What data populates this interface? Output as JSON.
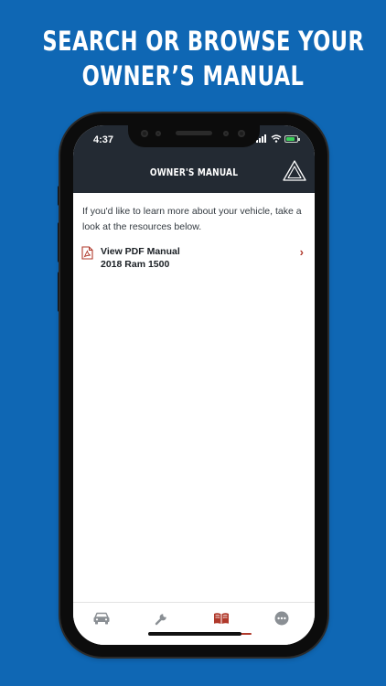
{
  "headline": {
    "line1": "SEARCH OR BROWSE YOUR",
    "line2": "OWNER’S MANUAL"
  },
  "status_bar": {
    "time": "4:37"
  },
  "nav": {
    "title": "OWNER'S MANUAL",
    "action_icon": "warning-triangle-icon"
  },
  "content": {
    "intro": "If you'd like to learn more about your vehicle, take a look at the resources below.",
    "manual": {
      "icon": "pdf-icon",
      "title": "View PDF Manual",
      "subtitle": "2018 Ram 1500",
      "chevron": "›"
    }
  },
  "tabs": [
    {
      "icon": "car-icon",
      "selected": false
    },
    {
      "icon": "wrench-icon",
      "selected": false
    },
    {
      "icon": "book-icon",
      "selected": true
    },
    {
      "icon": "more-icon",
      "selected": false
    }
  ],
  "colors": {
    "background": "#0f67b4",
    "header": "#232a33",
    "accent": "#b0392b"
  }
}
